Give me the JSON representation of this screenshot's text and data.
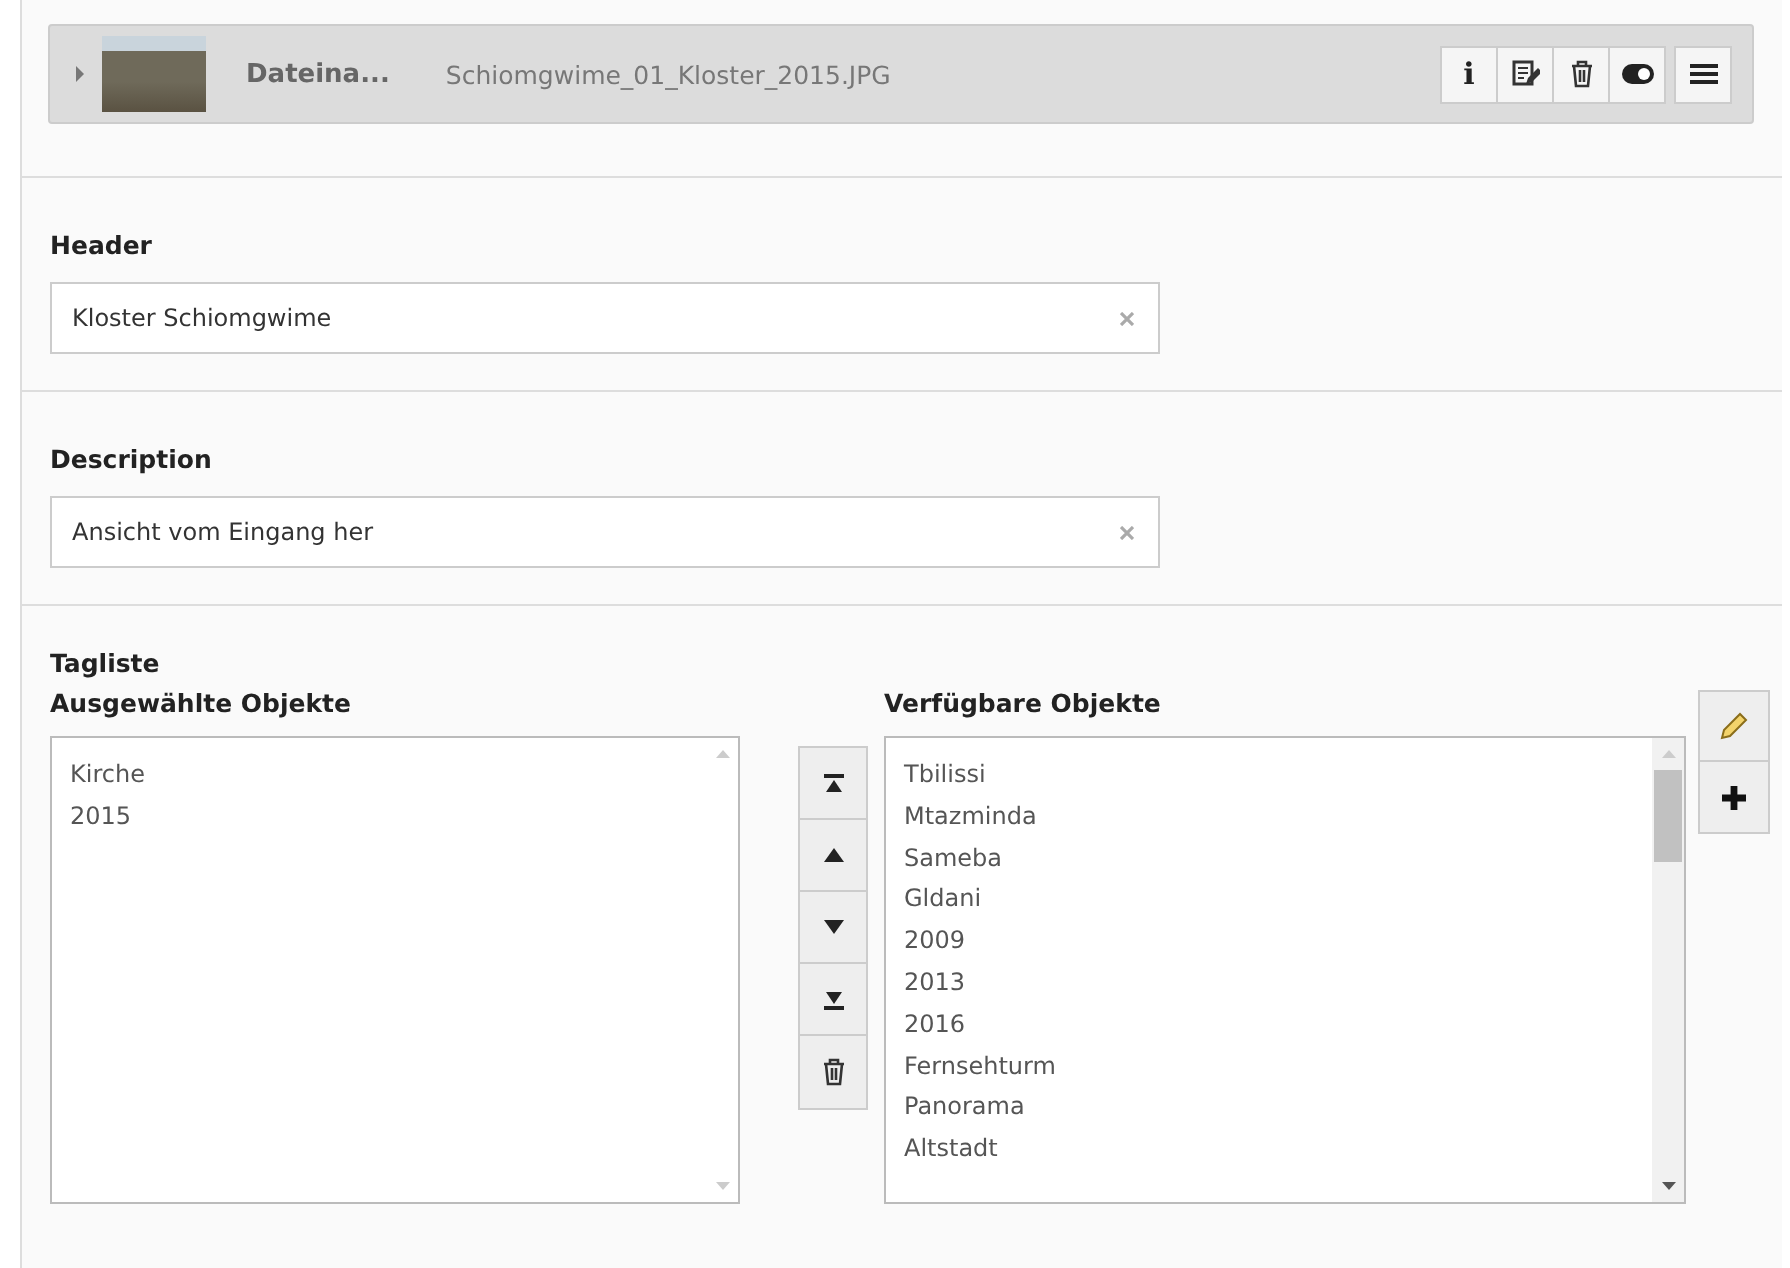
{
  "file_bar": {
    "expanded": false,
    "label": "Dateina...",
    "filename": "Schiomgwime_01_Kloster_2015.JPG",
    "actions": [
      {
        "kind": "info",
        "label": "i"
      },
      {
        "kind": "edit"
      },
      {
        "kind": "delete"
      },
      {
        "kind": "toggle"
      },
      {
        "kind": "menu"
      }
    ]
  },
  "header": {
    "label": "Header",
    "value": "Kloster Schiomgwime"
  },
  "description": {
    "label": "Description",
    "value": "Ansicht vom Eingang her"
  },
  "tag_list": {
    "label": "Tagliste",
    "selected_label": "Ausgewählte Objekte",
    "selected_items": [
      "Kirche",
      "2015"
    ],
    "move_buttons": [
      {
        "kind": "top"
      },
      {
        "kind": "up"
      },
      {
        "kind": "down"
      },
      {
        "kind": "bottom"
      },
      {
        "kind": "delete"
      }
    ],
    "available_label": "Verfügbare Objekte",
    "available_items": [
      "Tbilissi",
      "Mtazminda",
      "Sameba",
      "Gldani",
      "2009",
      "2013",
      "2016",
      "Fernsehturm",
      "Panorama",
      "Altstadt"
    ],
    "side_buttons": [
      {
        "kind": "edit"
      },
      {
        "kind": "add"
      }
    ]
  }
}
